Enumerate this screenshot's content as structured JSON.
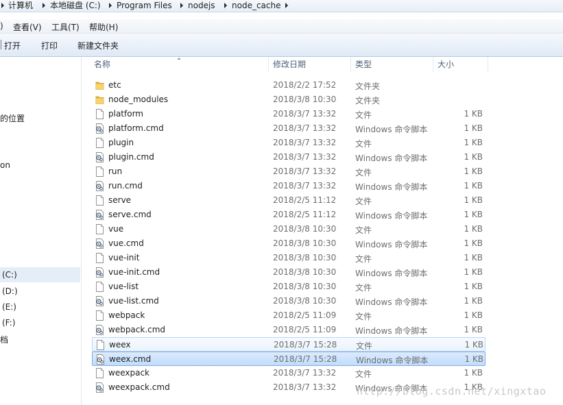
{
  "breadcrumb": [
    {
      "label": "计算机"
    },
    {
      "label": "本地磁盘 (C:)"
    },
    {
      "label": "Program Files"
    },
    {
      "label": "nodejs"
    },
    {
      "label": "node_cache"
    }
  ],
  "menu": {
    "prev_partial": ")",
    "items": [
      "查看(V)",
      "工具(T)",
      "帮助(H)"
    ]
  },
  "toolbar": {
    "open": "打开",
    "print": "打印",
    "new_folder": "新建文件夹"
  },
  "nav": {
    "locations": "的位置",
    "partial_on": "on",
    "drive_c": "(C:)",
    "drive_d": "(D:)",
    "drive_e": "(E:)",
    "drive_f": "(F:)",
    "docs": "档"
  },
  "columns": {
    "name": "名称",
    "date": "修改日期",
    "type": "类型",
    "size": "大小"
  },
  "files": [
    {
      "name": "etc",
      "date": "2018/2/2 17:52",
      "type": "文件夹",
      "size": "",
      "icon": "folder"
    },
    {
      "name": "node_modules",
      "date": "2018/3/8 10:30",
      "type": "文件夹",
      "size": "",
      "icon": "folder"
    },
    {
      "name": "platform",
      "date": "2018/3/7 13:32",
      "type": "文件",
      "size": "1 KB",
      "icon": "file"
    },
    {
      "name": "platform.cmd",
      "date": "2018/3/7 13:32",
      "type": "Windows 命令脚本",
      "size": "1 KB",
      "icon": "cmd"
    },
    {
      "name": "plugin",
      "date": "2018/3/7 13:32",
      "type": "文件",
      "size": "1 KB",
      "icon": "file"
    },
    {
      "name": "plugin.cmd",
      "date": "2018/3/7 13:32",
      "type": "Windows 命令脚本",
      "size": "1 KB",
      "icon": "cmd"
    },
    {
      "name": "run",
      "date": "2018/3/7 13:32",
      "type": "文件",
      "size": "1 KB",
      "icon": "file"
    },
    {
      "name": "run.cmd",
      "date": "2018/3/7 13:32",
      "type": "Windows 命令脚本",
      "size": "1 KB",
      "icon": "cmd"
    },
    {
      "name": "serve",
      "date": "2018/2/5 11:12",
      "type": "文件",
      "size": "1 KB",
      "icon": "file"
    },
    {
      "name": "serve.cmd",
      "date": "2018/2/5 11:12",
      "type": "Windows 命令脚本",
      "size": "1 KB",
      "icon": "cmd"
    },
    {
      "name": "vue",
      "date": "2018/3/8 10:30",
      "type": "文件",
      "size": "1 KB",
      "icon": "file"
    },
    {
      "name": "vue.cmd",
      "date": "2018/3/8 10:30",
      "type": "Windows 命令脚本",
      "size": "1 KB",
      "icon": "cmd"
    },
    {
      "name": "vue-init",
      "date": "2018/3/8 10:30",
      "type": "文件",
      "size": "1 KB",
      "icon": "file"
    },
    {
      "name": "vue-init.cmd",
      "date": "2018/3/8 10:30",
      "type": "Windows 命令脚本",
      "size": "1 KB",
      "icon": "cmd"
    },
    {
      "name": "vue-list",
      "date": "2018/3/8 10:30",
      "type": "文件",
      "size": "1 KB",
      "icon": "file"
    },
    {
      "name": "vue-list.cmd",
      "date": "2018/3/8 10:30",
      "type": "Windows 命令脚本",
      "size": "1 KB",
      "icon": "cmd"
    },
    {
      "name": "webpack",
      "date": "2018/2/5 11:09",
      "type": "文件",
      "size": "1 KB",
      "icon": "file"
    },
    {
      "name": "webpack.cmd",
      "date": "2018/2/5 11:09",
      "type": "Windows 命令脚本",
      "size": "1 KB",
      "icon": "cmd"
    },
    {
      "name": "weex",
      "date": "2018/3/7 15:28",
      "type": "文件",
      "size": "1 KB",
      "icon": "file",
      "state": "hover"
    },
    {
      "name": "weex.cmd",
      "date": "2018/3/7 15:28",
      "type": "Windows 命令脚本",
      "size": "1 KB",
      "icon": "cmd",
      "state": "selected"
    },
    {
      "name": "weexpack",
      "date": "2018/3/7 13:32",
      "type": "文件",
      "size": "1 KB",
      "icon": "file"
    },
    {
      "name": "weexpack.cmd",
      "date": "2018/3/7 13:32",
      "type": "Windows 命令脚本",
      "size": "1 KB",
      "icon": "cmd"
    }
  ],
  "watermark": "http://blog.csdn.net/xingxtao"
}
